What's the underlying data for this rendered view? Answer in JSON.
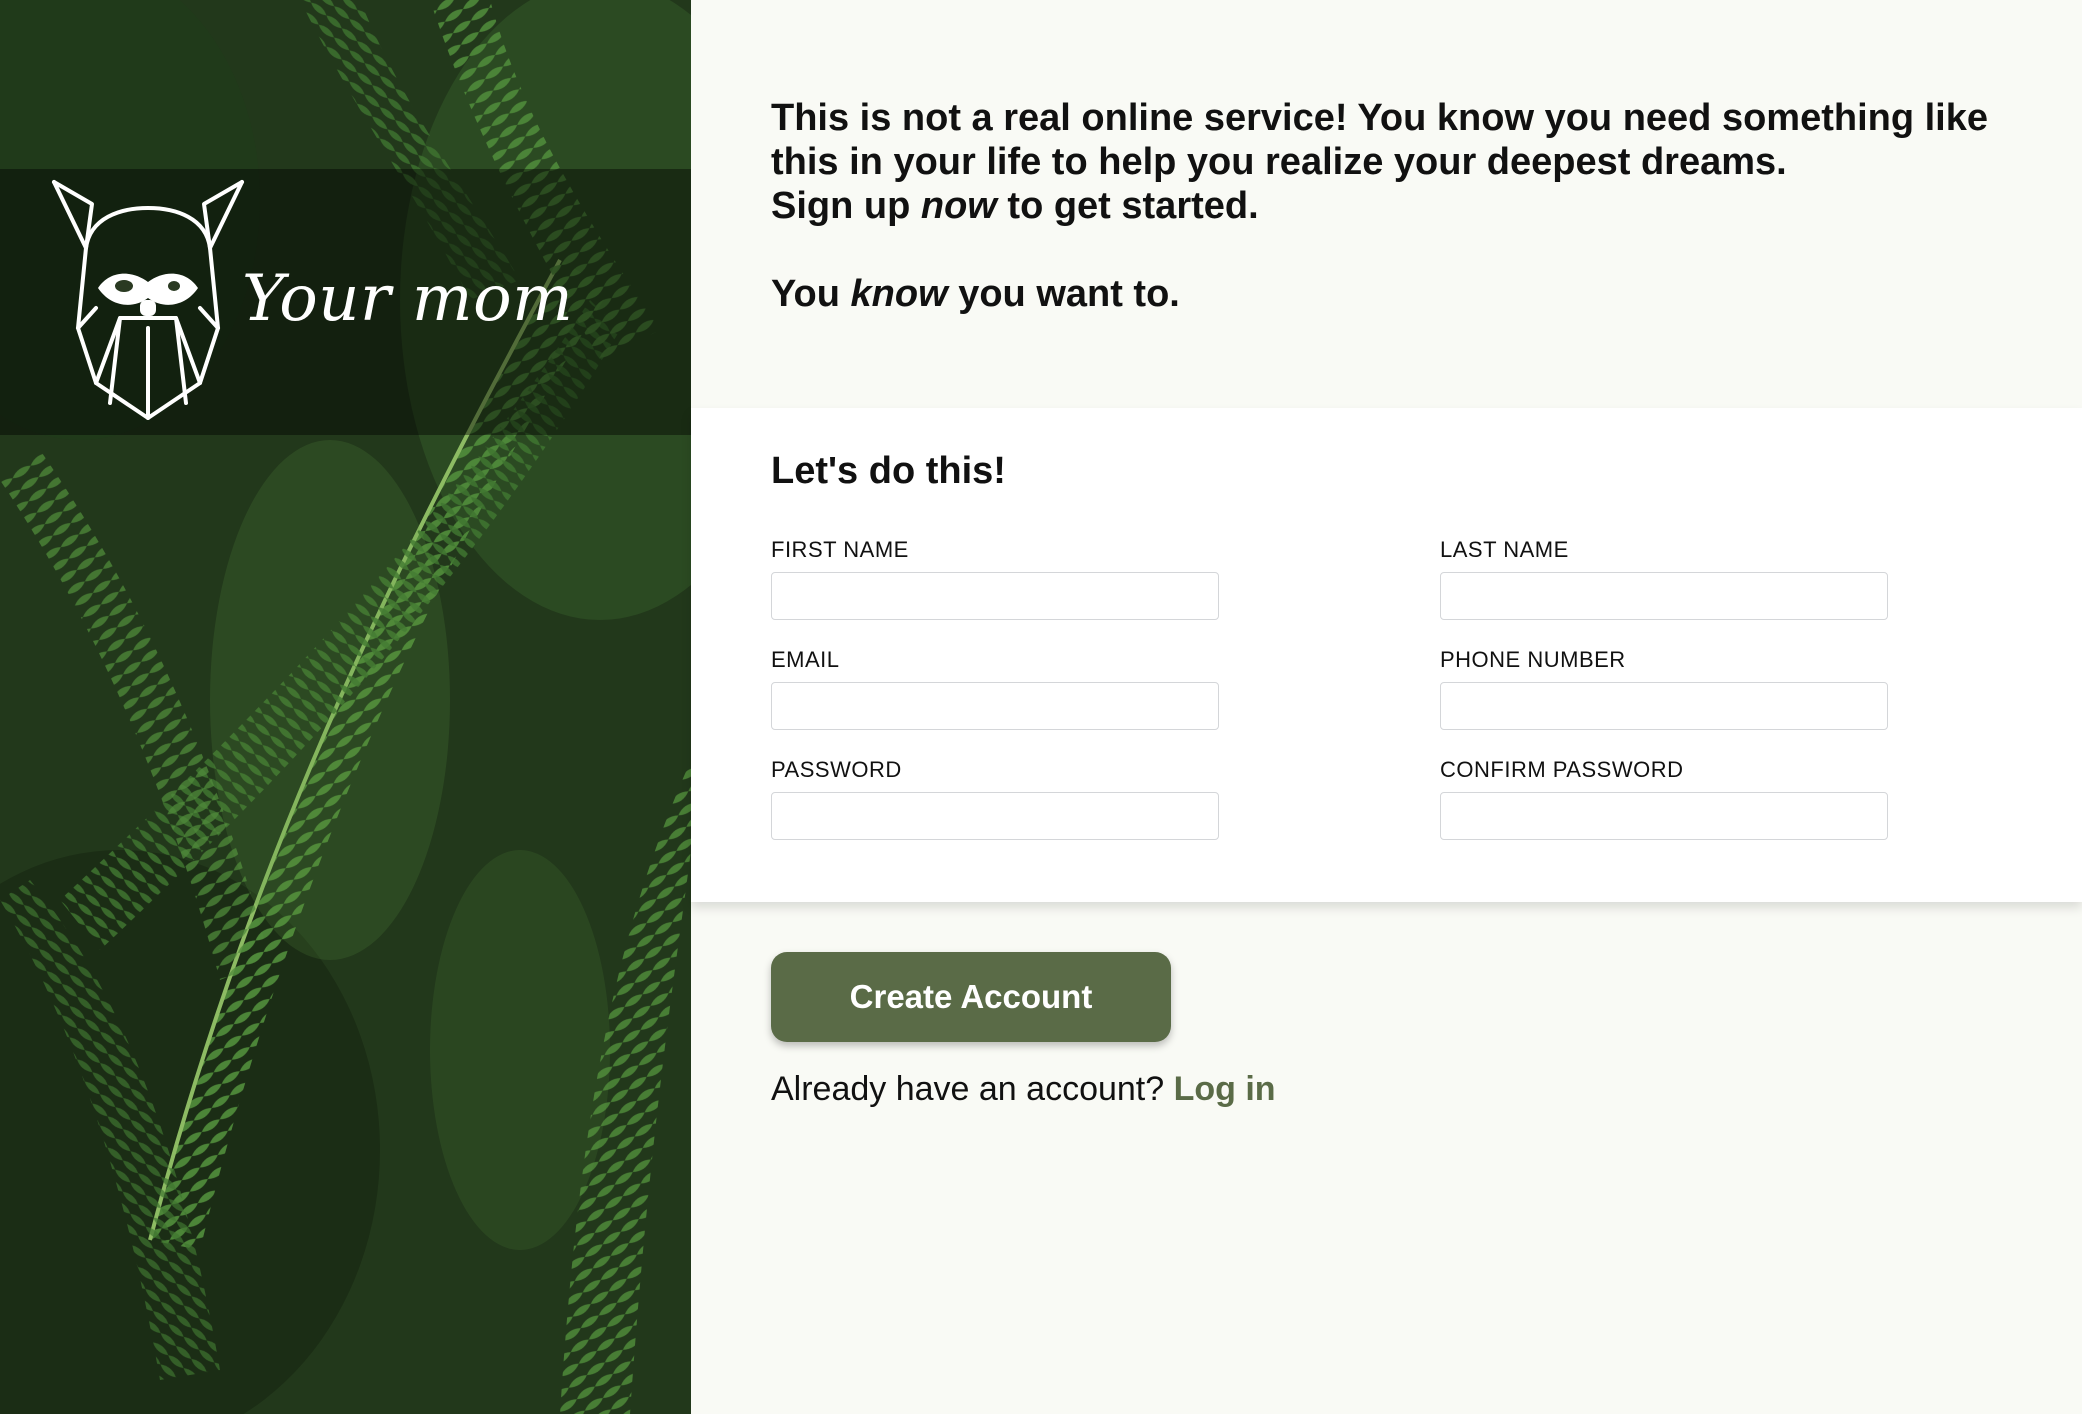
{
  "brand": {
    "logo_icon": "viking-head-icon",
    "name": "Your mom"
  },
  "intro": {
    "line1": "This is not a real online service! You know you need something like this in your life to help you realize your deepest dreams.",
    "line2_before": "Sign up ",
    "line2_em": "now",
    "line2_after": " to get started.",
    "line3_before": "You ",
    "line3_em": "know",
    "line3_after": " you want to."
  },
  "form": {
    "title": "Let's do this!",
    "fields": {
      "first_name": {
        "label": "FIRST NAME",
        "value": ""
      },
      "last_name": {
        "label": "LAST NAME",
        "value": ""
      },
      "email": {
        "label": "EMAIL",
        "value": ""
      },
      "phone": {
        "label": "PHONE NUMBER",
        "value": ""
      },
      "password": {
        "label": "PASSWORD",
        "value": ""
      },
      "confirm_password": {
        "label": "CONFIRM PASSWORD",
        "value": ""
      }
    }
  },
  "actions": {
    "create_label": "Create Account",
    "login_prompt": "Already have an account? ",
    "login_link": "Log in"
  },
  "colors": {
    "accent": "#5a6b47",
    "page_background": "#f9faf5",
    "card_background": "#ffffff"
  }
}
